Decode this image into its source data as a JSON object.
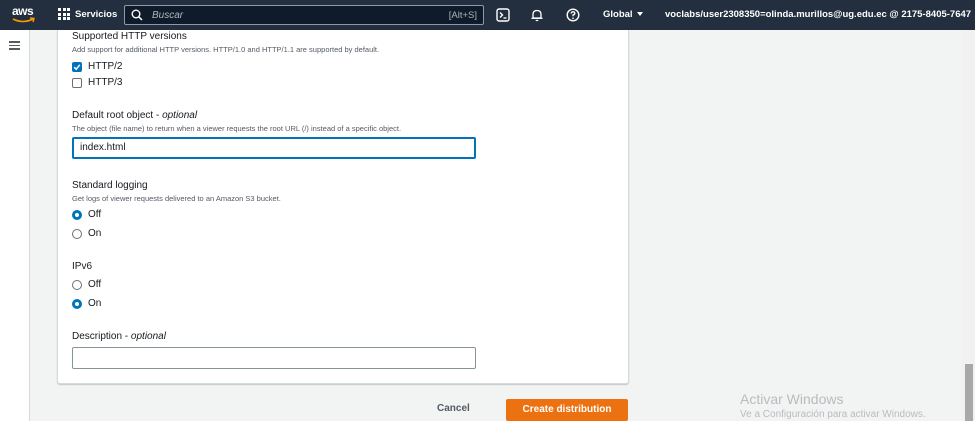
{
  "header": {
    "logo_text": "aws",
    "services_label": "Servicios",
    "search_placeholder": "Buscar",
    "search_shortcut": "[Alt+S]",
    "region_label": "Global",
    "account_label": "voclabs/user2308350=olinda.murillos@ug.edu.ec @ 2175-8405-7647"
  },
  "form": {
    "http_versions": {
      "label": "Supported HTTP versions",
      "description": "Add support for additional HTTP versions. HTTP/1.0 and HTTP/1.1 are supported by default.",
      "options": [
        {
          "label": "HTTP/2",
          "checked": true
        },
        {
          "label": "HTTP/3",
          "checked": false
        }
      ]
    },
    "root_object": {
      "label": "Default root object",
      "optional": "optional",
      "description": "The object (file name) to return when a viewer requests the root URL (/) instead of a specific object.",
      "value": "index.html"
    },
    "logging": {
      "label": "Standard logging",
      "description": "Get logs of viewer requests delivered to an Amazon S3 bucket.",
      "options": [
        {
          "label": "Off",
          "selected": true
        },
        {
          "label": "On",
          "selected": false
        }
      ]
    },
    "ipv6": {
      "label": "IPv6",
      "options": [
        {
          "label": "Off",
          "selected": false
        },
        {
          "label": "On",
          "selected": true
        }
      ]
    },
    "description": {
      "label": "Description",
      "optional": "optional",
      "value": ""
    }
  },
  "actions": {
    "cancel_label": "Cancel",
    "create_label": "Create distribution"
  },
  "watermark": {
    "title": "Activar Windows",
    "subtitle": "Ve a Configuración para activar Windows."
  },
  "colors": {
    "nav_bg": "#232f3e",
    "primary_button": "#ec7211",
    "accent_blue": "#0073bb"
  }
}
